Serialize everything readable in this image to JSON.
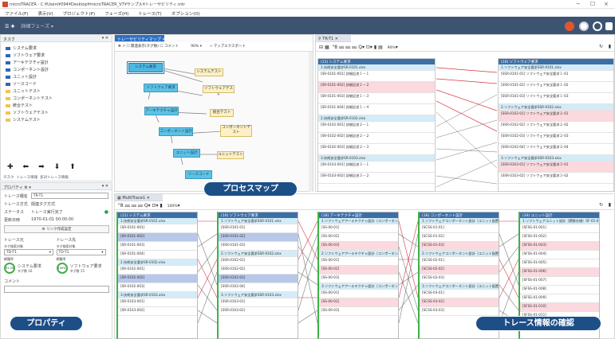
{
  "window": {
    "title": "microTRACER - C:¥Users¥094¥Desktop¥microTRACER_V7¥サンプル¥トレーサビリティ.mtr",
    "min": "−",
    "max": "☐",
    "close": "×"
  },
  "menu": [
    "ファイル(F)",
    "表示(V)",
    "プロジェクト(P)",
    "フェーズ(H)",
    "トレース(T)",
    "オプション(O)"
  ],
  "toolbar": {
    "phase_label": "詳細フェーズ"
  },
  "task_panel": {
    "tab": "タスク",
    "items": [
      "システム要求",
      "ソフトウェア要求",
      "アーキテクチャ設計",
      "コンポーネント設計",
      "ユニット設計",
      "ソースコード",
      "ユニットテスト",
      "コンポーネントテスト",
      "統合テスト",
      "ソフトウェアテスト",
      "システムテスト"
    ],
    "tabs": [
      "タスク",
      "トレース情報",
      "多対トレース情報"
    ]
  },
  "property_panel": {
    "title": "プロパティ",
    "fields": [
      {
        "label": "トレース種名",
        "value": "TR-T1"
      },
      {
        "label": "トレース方式",
        "value": "関連タグ方式"
      },
      {
        "label": "ステータス",
        "value": "トレース実行完了"
      },
      {
        "label": "更新日時",
        "value": "1970-01-01 00:00:00"
      }
    ],
    "link_button": "リンク作成設定",
    "source_label": "トレース元",
    "target_label": "トレース先",
    "source_sub": "タグ検索対象",
    "target_sub": "タグ検索対象",
    "source_value": "TD-T1",
    "target_value": "TD-T1",
    "cov_label": "網羅率",
    "source_cov": "91.2%",
    "target_cov": "100%",
    "source_doc": "システム要求",
    "target_doc": "ソフトウェア要求",
    "source_tag": "タグ数 16",
    "target_tag": "タグ数 15",
    "comment_label": "コメント"
  },
  "process_map": {
    "tab": "トレーサビリティマップ",
    "checkbox1": "関連表示(タグ数)",
    "checkbox2": "コメント",
    "zoom": "90%",
    "export": "マップエクスポート",
    "boxes": {
      "sys": "システム要求",
      "swreq": "ソフトウェア要求",
      "arch": "アーキテクチャ設計",
      "comp": "コンポーネント設計",
      "unit": "ユニット設計",
      "src": "ソースコード",
      "systest": "システムテスト",
      "swtest": "ソフトウェアテスト",
      "inttest": "統合テスト",
      "comptest": "コンポーネントテスト",
      "unittest": "ユニットテスト"
    }
  },
  "trace_view": {
    "tab": "TR-T1",
    "zoom": "90%",
    "left_header": "(11) システム要求",
    "right_header": "(10) ソフトウェア要求",
    "left_rows": [
      {
        "t": "1.技術安全要求SR-0101.xlsx",
        "k": "sec"
      },
      {
        "t": "[SR-0101-001] 詳細記述１－１",
        "k": ""
      },
      {
        "t": "[SR-0101-002] 詳細記述１－２",
        "k": "hl"
      },
      {
        "t": "[SR-0101-003] 詳細記述１－３",
        "k": ""
      },
      {
        "t": "[SR-0101-004] 詳細記述１－４",
        "k": ""
      },
      {
        "t": "2.技術安全要求SR-0102.xlsx",
        "k": "sec"
      },
      {
        "t": "[SR-0102-001] 詳細記述２－１",
        "k": ""
      },
      {
        "t": "[SR-0102-002] 詳細記述２－２",
        "k": ""
      },
      {
        "t": "[SR-0102-003] 詳細記述２－３",
        "k": ""
      },
      {
        "t": "3.技術安全要求SR-0103.xlsx",
        "k": "sec"
      },
      {
        "t": "[SR-0103-001] 詳細記述３－１",
        "k": ""
      },
      {
        "t": "[SR-0103-002] 詳細記述３－２",
        "k": ""
      }
    ],
    "right_rows": [
      {
        "t": "1.ソフトウェア安全要求SSR-0101.xlsx",
        "k": "sec"
      },
      {
        "t": "[SSR-0101-01] ソフトウェア安全要求１-01",
        "k": ""
      },
      {
        "t": "[SSR-0101-02] ソフトウェア安全要求１-02",
        "k": ""
      },
      {
        "t": "[SSR-0101-03] ソフトウェア安全要求１-03",
        "k": ""
      },
      {
        "t": "2.ソフトウェア安全要求SSR-0102.xlsx",
        "k": "sec"
      },
      {
        "t": "[SSR-0102-01] ソフトウェア安全要求２-01",
        "k": "hl"
      },
      {
        "t": "[SSR-0102-02] ソフトウェア安全要求２-02",
        "k": ""
      },
      {
        "t": "[SSR-0102-03] ソフトウェア安全要求２-03",
        "k": ""
      },
      {
        "t": "[SSR-0102-04] ソフトウェア安全要求２-04",
        "k": ""
      },
      {
        "t": "3.ソフトウェア安全要求SSR-0103.xlsx",
        "k": "sec"
      },
      {
        "t": "[SSR-0103-01] ソフトウェア安全要求３-01",
        "k": "hl"
      },
      {
        "t": "[SSR-0103-02] ソフトウェア安全要求３-02",
        "k": ""
      }
    ]
  },
  "multi_trace": {
    "tab": "MultiTrace1",
    "zoom": "100%",
    "columns": [
      {
        "header": "(11) システム要求",
        "rows": [
          "1.技術安全要求SR-0101.xlsx",
          "[SR-0101-001]",
          "[SR-0101-002]",
          "[SR-0101-003]",
          "[SR-0101-004]",
          "2.技術安全要求SR-0102.xlsx",
          "[SR-0102-001]",
          "[SR-0102-002]",
          "[SR-0102-003]",
          "3.技術安全要求SR-0103.xlsx",
          "[SR-0103-001]",
          "[SR-0103-002]"
        ]
      },
      {
        "header": "(10) ソフトウェア要求",
        "rows": [
          "1.ソフトウェア安全要求SSR-0101.xlsx",
          "[SSR-0101-01]",
          "[SSR-0101-02]",
          "[SSR-0101-03]",
          "2.ソフトウェア安全要求SSR-0102.xlsx",
          "[SSR-0102-01]",
          "[SSR-0102-02]",
          "[SSR-0102-03]",
          "[SSR-0102-04]",
          "3.ソフトウェア安全要求SSR-0103.xlsx",
          "[SSR-0103-01]",
          "[SSR-0103-02]"
        ]
      },
      {
        "header": "(18) アーキテクチャ設計",
        "rows": [
          "1.ソフトウェアアーキテクチャ設計（コンポーネント配置",
          "[SS-00-01]",
          "[SS-00-02]",
          "[SS-00-03]",
          "2.ソフトウェアアーキテクチャ設計（コンポーネント配置",
          "[SS-00-01]",
          "[SS-00-02]",
          "[SS-00-03]",
          "3.ソフトウェアアーキテクチャ設計（コンポーネント配置",
          "[SS-00-01]",
          "[SS-00-02]",
          "[SS-00-03]"
        ]
      },
      {
        "header": "(16) コンポーネント設計",
        "rows": [
          "1.ソフトウェアコンポーネント設計（ユニット配置",
          "[SCSS-01-01]",
          "[SCSS-01-02]",
          "[SCSS-01-03]",
          "2.ソフトウェアコンポーネント設計（ユニット配置",
          "[SCSS-02-01]",
          "[SCSS-02-02]",
          "[SCSS-02-03]",
          "3.ソフトウェアコンポーネント設計（ユニット配置",
          "[SCSS-03-01]",
          "[SCSS-03-02]",
          "[SCSS-03-03]"
        ]
      },
      {
        "header": "(34) ユニット設計",
        "rows": [
          "1.ソフトウェアユニット設計（関数仕様）SF-01-0",
          "[SFSS-01-001]",
          "[SFSS-01-002]",
          "[SFSS-01-003]",
          "[SFSS-01-004]",
          "[SFSS-01-005]",
          "[SFSS-01-006]",
          "[SFSS-01-007]",
          "[SFSS-01-008]",
          "[SFSS-01-009]",
          "[SFSS-01-010]",
          "[SFSS-01-011]"
        ]
      }
    ]
  },
  "callouts": {
    "process_map": "プロセスマップ",
    "property": "プロパティ",
    "trace_check": "トレース情報の確認"
  },
  "colors": {
    "header_blue": "#3d6fa7",
    "toolbar": "#3d5372",
    "callout": "#1d4f87",
    "link_red": "#d8343f",
    "link_gray": "#7a7a7a"
  }
}
